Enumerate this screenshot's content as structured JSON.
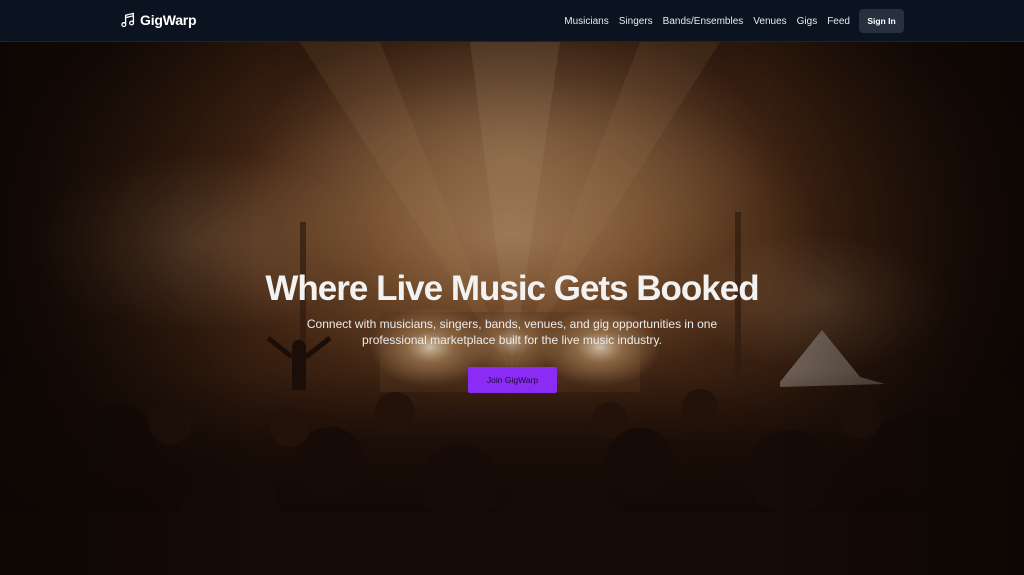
{
  "navbar": {
    "brand": "GigWarp",
    "brand_icon": "music-note-icon",
    "links": [
      "Musicians",
      "Singers",
      "Bands/Ensembles",
      "Venues",
      "Gigs",
      "Feed"
    ],
    "signin_label": "Sign In",
    "background_color": "#0b1220"
  },
  "hero": {
    "title": "Where Live Music Gets Booked",
    "subtitle": "Connect with musicians, singers, bands, venues, and gig opportunities in one professional marketplace built for the live music industry.",
    "cta_label": "Join GigWarp",
    "cta_color": "#8b2cf5",
    "background_image": "concert-crowd-photo"
  }
}
